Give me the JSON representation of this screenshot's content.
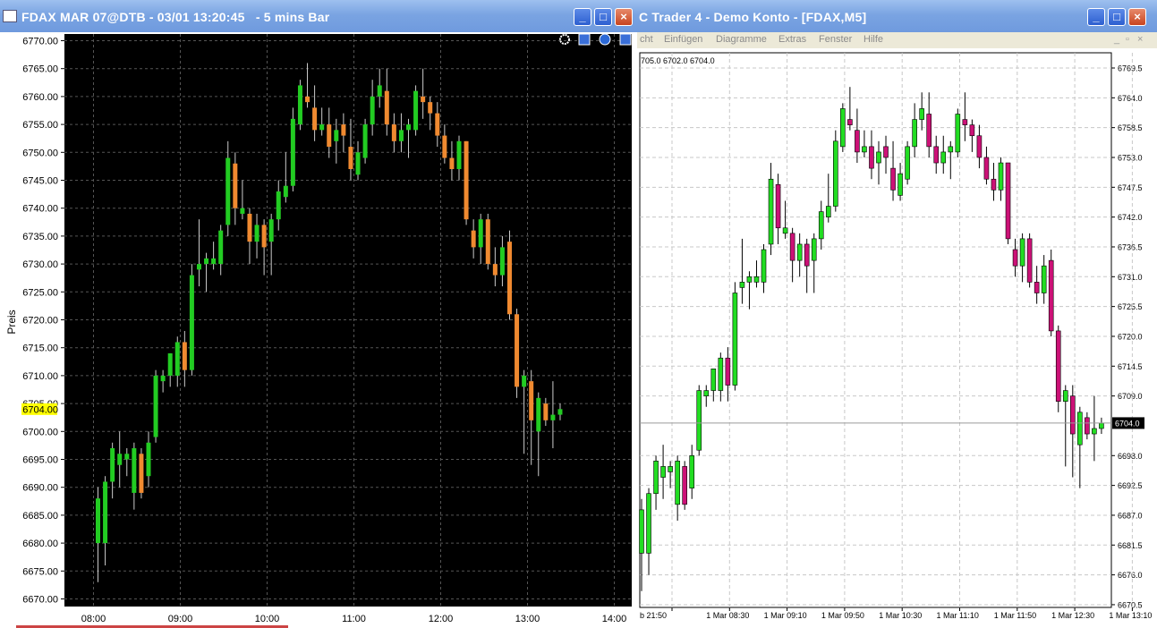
{
  "left_window": {
    "title": "FDAX MAR 07@DTB - 03/01 13:20:45   - 5 mins Bar",
    "ylabel": "Preis",
    "current_price": "6704.00",
    "y_ticks": [
      "6770.00",
      "6765.00",
      "6760.00",
      "6755.00",
      "6750.00",
      "6745.00",
      "6740.00",
      "6735.00",
      "6730.00",
      "6725.00",
      "6720.00",
      "6715.00",
      "6710.00",
      "6705.00",
      "6700.00",
      "6695.00",
      "6690.00",
      "6685.00",
      "6680.00",
      "6675.00",
      "6670.00"
    ],
    "x_ticks": [
      "08:00",
      "09:00",
      "10:00",
      "11:00",
      "12:00",
      "13:00",
      "14:00"
    ],
    "controls": [
      "settings-icon",
      "window-icon",
      "help-icon",
      "expand-icon"
    ],
    "colors": {
      "background": "#000000",
      "up": "#22cc22",
      "down": "#f08a30",
      "grid": "#555555",
      "highlight": "#ffff00"
    }
  },
  "right_window": {
    "title": "C Trader 4 - Demo Konto - [FDAX,M5]",
    "menu": [
      "cht",
      "Einfügen",
      "Diagramme",
      "Extras",
      "Fenster",
      "Hilfe"
    ],
    "ohlc_header": "705.0 6702.0 6704.0",
    "current_price": "6704.0",
    "y_ticks": [
      "6769.5",
      "6764.0",
      "6758.5",
      "6753.0",
      "6747.5",
      "6742.0",
      "6736.5",
      "6731.0",
      "6725.5",
      "6720.0",
      "6714.5",
      "6709.0",
      "6698.0",
      "6692.5",
      "6687.0",
      "6681.5",
      "6676.0",
      "6670.5"
    ],
    "x_ticks": [
      "b 21:50",
      "1 Mar 08:30",
      "1 Mar 09:10",
      "1 Mar 09:50",
      "1 Mar 10:30",
      "1 Mar 11:10",
      "1 Mar 11:50",
      "1 Mar 12:30",
      "1 Mar 13:10"
    ],
    "colors": {
      "background": "#ffffff",
      "up": "#22dd22",
      "down": "#cc1177",
      "grid": "#c8c8c8"
    }
  },
  "chart_data": {
    "type": "candlestick",
    "series": [
      {
        "name": "FDAX 5 mins",
        "bars": [
          {
            "o": 6680,
            "h": 6690,
            "l": 6673,
            "c": 6688
          },
          {
            "o": 6680,
            "h": 6692,
            "l": 6676,
            "c": 6691
          },
          {
            "o": 6691,
            "h": 6698,
            "l": 6688,
            "c": 6697
          },
          {
            "o": 6694,
            "h": 6700,
            "l": 6690,
            "c": 6696
          },
          {
            "o": 6695,
            "h": 6697,
            "l": 6692,
            "c": 6696
          },
          {
            "o": 6689,
            "h": 6698,
            "l": 6686,
            "c": 6697
          },
          {
            "o": 6696,
            "h": 6697,
            "l": 6688,
            "c": 6689
          },
          {
            "o": 6692,
            "h": 6700,
            "l": 6690,
            "c": 6698
          },
          {
            "o": 6699,
            "h": 6711,
            "l": 6698,
            "c": 6710
          },
          {
            "o": 6709,
            "h": 6711,
            "l": 6707,
            "c": 6710
          },
          {
            "o": 6710,
            "h": 6714,
            "l": 6708,
            "c": 6714
          },
          {
            "o": 6710,
            "h": 6717,
            "l": 6708,
            "c": 6716
          },
          {
            "o": 6716,
            "h": 6718,
            "l": 6708,
            "c": 6711
          },
          {
            "o": 6711,
            "h": 6730,
            "l": 6710,
            "c": 6728
          },
          {
            "o": 6729,
            "h": 6738,
            "l": 6726,
            "c": 6730
          },
          {
            "o": 6730,
            "h": 6732,
            "l": 6725,
            "c": 6731
          },
          {
            "o": 6730,
            "h": 6734,
            "l": 6729,
            "c": 6731
          },
          {
            "o": 6730,
            "h": 6737,
            "l": 6728,
            "c": 6736
          },
          {
            "o": 6737,
            "h": 6752,
            "l": 6735,
            "c": 6749
          },
          {
            "o": 6748,
            "h": 6750,
            "l": 6737,
            "c": 6740
          },
          {
            "o": 6739,
            "h": 6745,
            "l": 6738,
            "c": 6740
          },
          {
            "o": 6739,
            "h": 6740,
            "l": 6730,
            "c": 6734
          },
          {
            "o": 6734,
            "h": 6739,
            "l": 6731,
            "c": 6737
          },
          {
            "o": 6737,
            "h": 6738,
            "l": 6728,
            "c": 6733
          },
          {
            "o": 6734,
            "h": 6739,
            "l": 6728,
            "c": 6738
          },
          {
            "o": 6738,
            "h": 6745,
            "l": 6736,
            "c": 6743
          },
          {
            "o": 6742,
            "h": 6750,
            "l": 6741,
            "c": 6744
          },
          {
            "o": 6744,
            "h": 6758,
            "l": 6743,
            "c": 6756
          },
          {
            "o": 6755,
            "h": 6763,
            "l": 6754,
            "c": 6762
          },
          {
            "o": 6760,
            "h": 6766,
            "l": 6758,
            "c": 6759
          },
          {
            "o": 6758,
            "h": 6762,
            "l": 6752,
            "c": 6754
          },
          {
            "o": 6754,
            "h": 6758,
            "l": 6753,
            "c": 6755
          },
          {
            "o": 6755,
            "h": 6758,
            "l": 6749,
            "c": 6751
          },
          {
            "o": 6752,
            "h": 6756,
            "l": 6748,
            "c": 6754
          },
          {
            "o": 6755,
            "h": 6757,
            "l": 6750,
            "c": 6753
          },
          {
            "o": 6751,
            "h": 6756,
            "l": 6745,
            "c": 6747
          },
          {
            "o": 6746,
            "h": 6752,
            "l": 6745,
            "c": 6750
          },
          {
            "o": 6749,
            "h": 6756,
            "l": 6748,
            "c": 6755
          },
          {
            "o": 6755,
            "h": 6763,
            "l": 6753,
            "c": 6760
          },
          {
            "o": 6760,
            "h": 6765,
            "l": 6758,
            "c": 6762
          },
          {
            "o": 6761,
            "h": 6765,
            "l": 6753,
            "c": 6755
          },
          {
            "o": 6755,
            "h": 6757,
            "l": 6750,
            "c": 6752
          },
          {
            "o": 6752,
            "h": 6757,
            "l": 6750,
            "c": 6754
          },
          {
            "o": 6754,
            "h": 6756,
            "l": 6749,
            "c": 6755
          },
          {
            "o": 6754,
            "h": 6762,
            "l": 6753,
            "c": 6761
          },
          {
            "o": 6760,
            "h": 6765,
            "l": 6756,
            "c": 6759
          },
          {
            "o": 6759,
            "h": 6760,
            "l": 6754,
            "c": 6757
          },
          {
            "o": 6757,
            "h": 6759,
            "l": 6751,
            "c": 6753
          },
          {
            "o": 6753,
            "h": 6755,
            "l": 6748,
            "c": 6749
          },
          {
            "o": 6749,
            "h": 6752,
            "l": 6745,
            "c": 6747
          },
          {
            "o": 6747,
            "h": 6753,
            "l": 6745,
            "c": 6752
          },
          {
            "o": 6752,
            "h": 6752,
            "l": 6737,
            "c": 6738
          },
          {
            "o": 6736,
            "h": 6738,
            "l": 6731,
            "c": 6733
          },
          {
            "o": 6733,
            "h": 6739,
            "l": 6730,
            "c": 6738
          },
          {
            "o": 6738,
            "h": 6739,
            "l": 6729,
            "c": 6730
          },
          {
            "o": 6730,
            "h": 6733,
            "l": 6726,
            "c": 6728
          },
          {
            "o": 6728,
            "h": 6735,
            "l": 6726,
            "c": 6733
          },
          {
            "o": 6734,
            "h": 6736,
            "l": 6720,
            "c": 6721
          },
          {
            "o": 6721,
            "h": 6722,
            "l": 6706,
            "c": 6708
          },
          {
            "o": 6708,
            "h": 6711,
            "l": 6696,
            "c": 6710
          },
          {
            "o": 6709,
            "h": 6711,
            "l": 6694,
            "c": 6702
          },
          {
            "o": 6700,
            "h": 6707,
            "l": 6692,
            "c": 6706
          },
          {
            "o": 6705,
            "h": 6706,
            "l": 6701,
            "c": 6702
          },
          {
            "o": 6702,
            "h": 6709,
            "l": 6697,
            "c": 6703
          },
          {
            "o": 6703,
            "h": 6705,
            "l": 6702,
            "c": 6704
          }
        ]
      }
    ],
    "ylabel": "Preis"
  }
}
